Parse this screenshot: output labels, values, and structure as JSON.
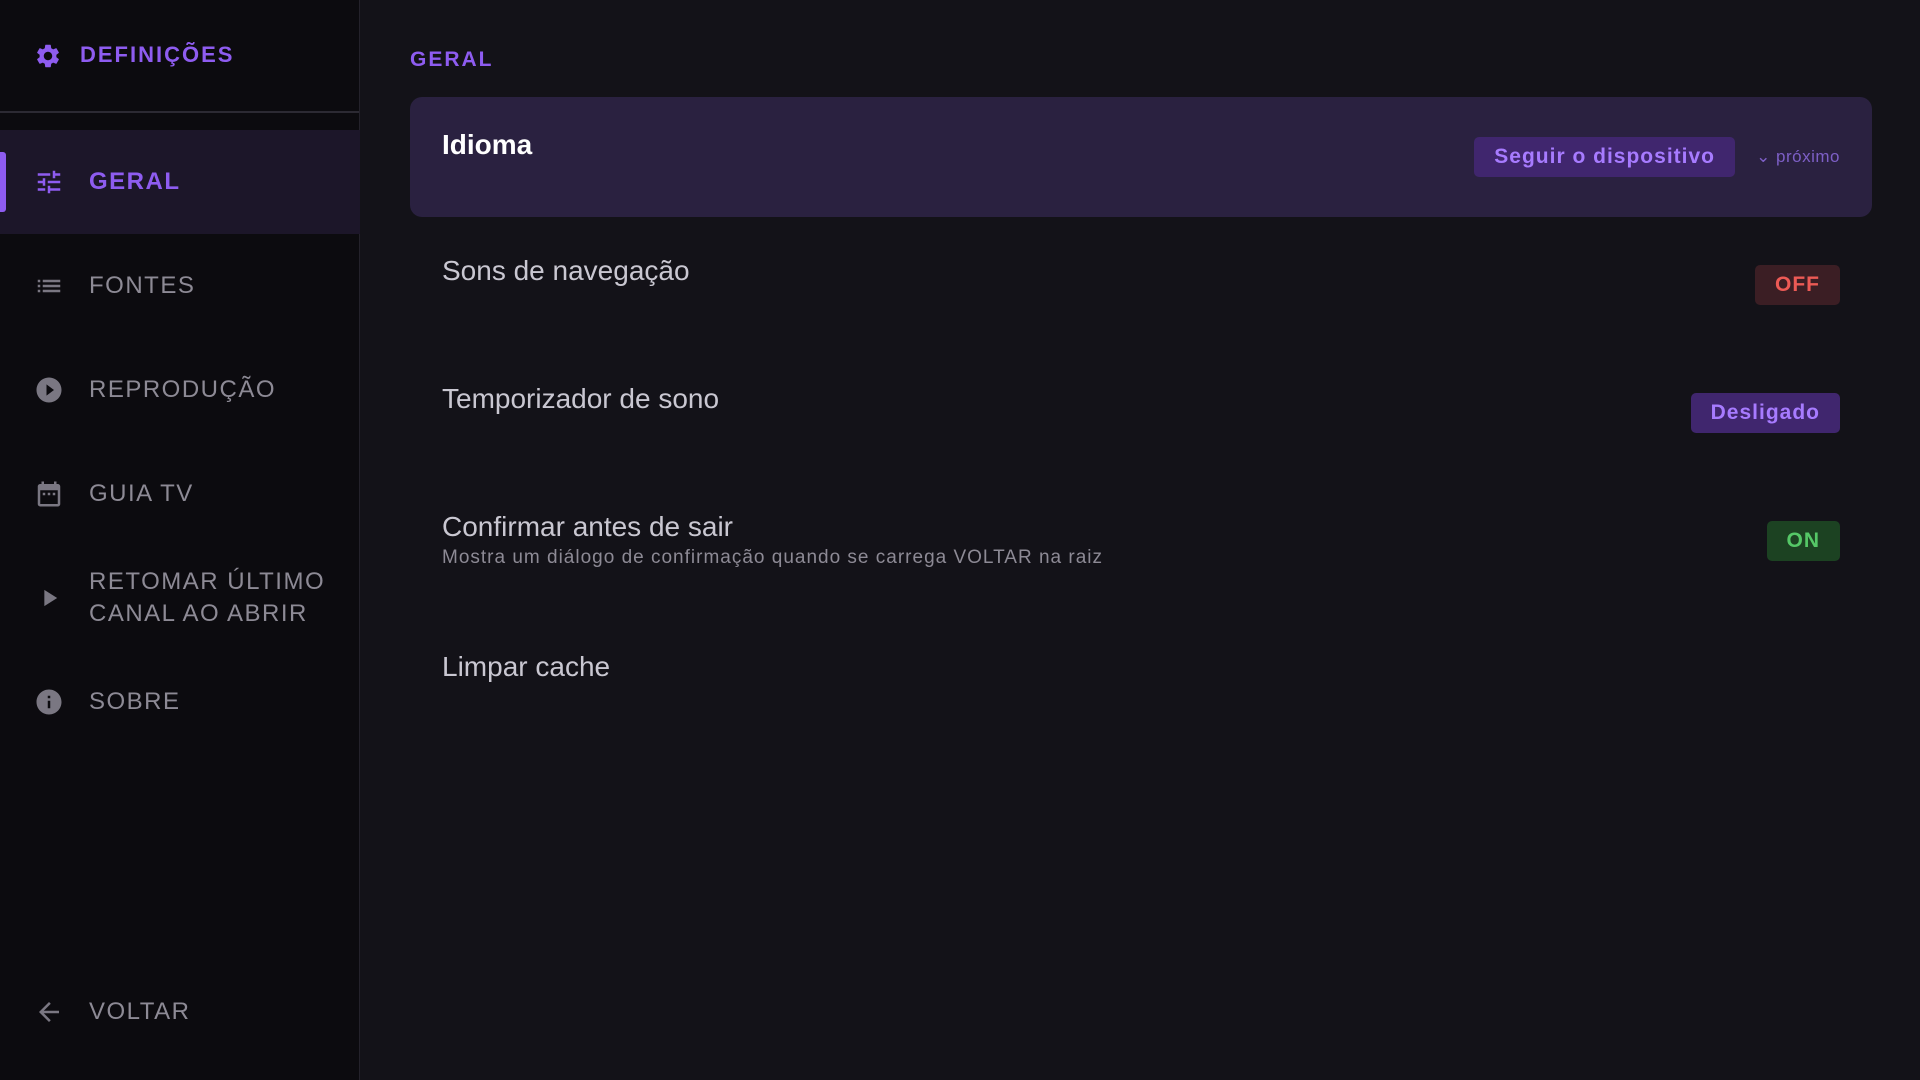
{
  "header": {
    "title": "DEFINIÇÕES",
    "icon": "gear-icon"
  },
  "sidebar": {
    "items": [
      {
        "label": "GERAL",
        "icon": "tune-icon",
        "active": true
      },
      {
        "label": "FONTES",
        "icon": "list-icon"
      },
      {
        "label": "REPRODUÇÃO",
        "icon": "play-circle-icon"
      },
      {
        "label": "GUIA TV",
        "icon": "calendar-icon"
      },
      {
        "label": "RETOMAR ÚLTIMO\nCANAL AO ABRIR",
        "icon": "play-arrow-icon"
      },
      {
        "label": "SOBRE",
        "icon": "info-icon"
      }
    ],
    "back_label": "VOLTAR"
  },
  "main": {
    "section_title": "GERAL",
    "settings": [
      {
        "name": "Idioma",
        "value": "Seguir o dispositivo",
        "hint": "⌄ próximo",
        "selected": true
      },
      {
        "name": "Sons de navegação",
        "value": "OFF"
      },
      {
        "name": "Temporizador de sono",
        "value": "Desligado"
      },
      {
        "name": "Confirmar antes de sair",
        "description": "Mostra um diálogo de confirmação quando se carrega VOLTAR na raiz",
        "value": "ON"
      },
      {
        "name": "Limpar cache"
      }
    ]
  },
  "colors": {
    "accent": "#8e5cf0",
    "off": "#ec5a55",
    "on": "#55c767",
    "background": "#131218",
    "sidebar": "#0c0b0f"
  }
}
